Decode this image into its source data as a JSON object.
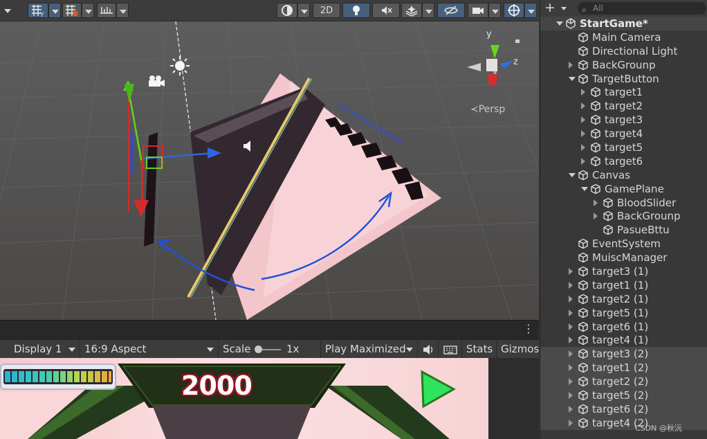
{
  "scene": {
    "toolbar": {
      "shading_mode": "2D"
    },
    "orientation_gizmo": {
      "y_label": "y",
      "z_label": "z",
      "projection_label": "Persp"
    }
  },
  "game": {
    "display": "Display 1",
    "aspect": "16:9 Aspect",
    "scale_label": "Scale",
    "scale_value": "1x",
    "play_mode": "Play Maximized",
    "stats": "Stats",
    "gizmos": "Gizmos",
    "score": "2000",
    "blood_level": 1.0
  },
  "hierarchy": {
    "search_placeholder": "All",
    "items": [
      {
        "label": "StartGame*",
        "depth": 0,
        "fold": "expanded",
        "root": true
      },
      {
        "label": "Main Camera",
        "depth": 1,
        "fold": "none"
      },
      {
        "label": "Directional Light",
        "depth": 1,
        "fold": "none"
      },
      {
        "label": "BackGrounp",
        "depth": 1,
        "fold": "collapsed"
      },
      {
        "label": "TargetButton",
        "depth": 1,
        "fold": "expanded"
      },
      {
        "label": "target1",
        "depth": 2,
        "fold": "collapsed"
      },
      {
        "label": "target2",
        "depth": 2,
        "fold": "collapsed"
      },
      {
        "label": "target3",
        "depth": 2,
        "fold": "collapsed"
      },
      {
        "label": "target4",
        "depth": 2,
        "fold": "collapsed"
      },
      {
        "label": "target5",
        "depth": 2,
        "fold": "collapsed"
      },
      {
        "label": "target6",
        "depth": 2,
        "fold": "collapsed"
      },
      {
        "label": "Canvas",
        "depth": 1,
        "fold": "expanded"
      },
      {
        "label": "GamePlane",
        "depth": 2,
        "fold": "expanded"
      },
      {
        "label": "BloodSlider",
        "depth": 3,
        "fold": "collapsed"
      },
      {
        "label": "BackGrounp",
        "depth": 3,
        "fold": "collapsed"
      },
      {
        "label": "PasueBttu",
        "depth": 3,
        "fold": "none"
      },
      {
        "label": "EventSystem",
        "depth": 1,
        "fold": "none"
      },
      {
        "label": "MuiscManager",
        "depth": 1,
        "fold": "none"
      },
      {
        "label": "target3  (1)",
        "depth": 1,
        "fold": "collapsed"
      },
      {
        "label": "target1  (1)",
        "depth": 1,
        "fold": "collapsed"
      },
      {
        "label": "target2  (1)",
        "depth": 1,
        "fold": "collapsed"
      },
      {
        "label": "target5  (1)",
        "depth": 1,
        "fold": "collapsed"
      },
      {
        "label": "target6  (1)",
        "depth": 1,
        "fold": "collapsed"
      },
      {
        "label": "target4  (1)",
        "depth": 1,
        "fold": "collapsed"
      },
      {
        "label": "target3  (2)",
        "depth": 1,
        "fold": "collapsed",
        "selected": true
      },
      {
        "label": "target1  (2)",
        "depth": 1,
        "fold": "collapsed",
        "selected": true
      },
      {
        "label": "target2  (2)",
        "depth": 1,
        "fold": "collapsed",
        "selected": true
      },
      {
        "label": "target5  (2)",
        "depth": 1,
        "fold": "collapsed",
        "selected": true
      },
      {
        "label": "target6  (2)",
        "depth": 1,
        "fold": "collapsed",
        "selected": true
      },
      {
        "label": "target4  (2)",
        "depth": 1,
        "fold": "collapsed",
        "selected": true
      }
    ]
  },
  "watermark": "CSDN @秋沅",
  "colors": {
    "selected_axis_x": "#d62c2c",
    "axis_y": "#6bd41a",
    "axis_z": "#2f6fe0",
    "toolbar_active": "#46607c"
  }
}
